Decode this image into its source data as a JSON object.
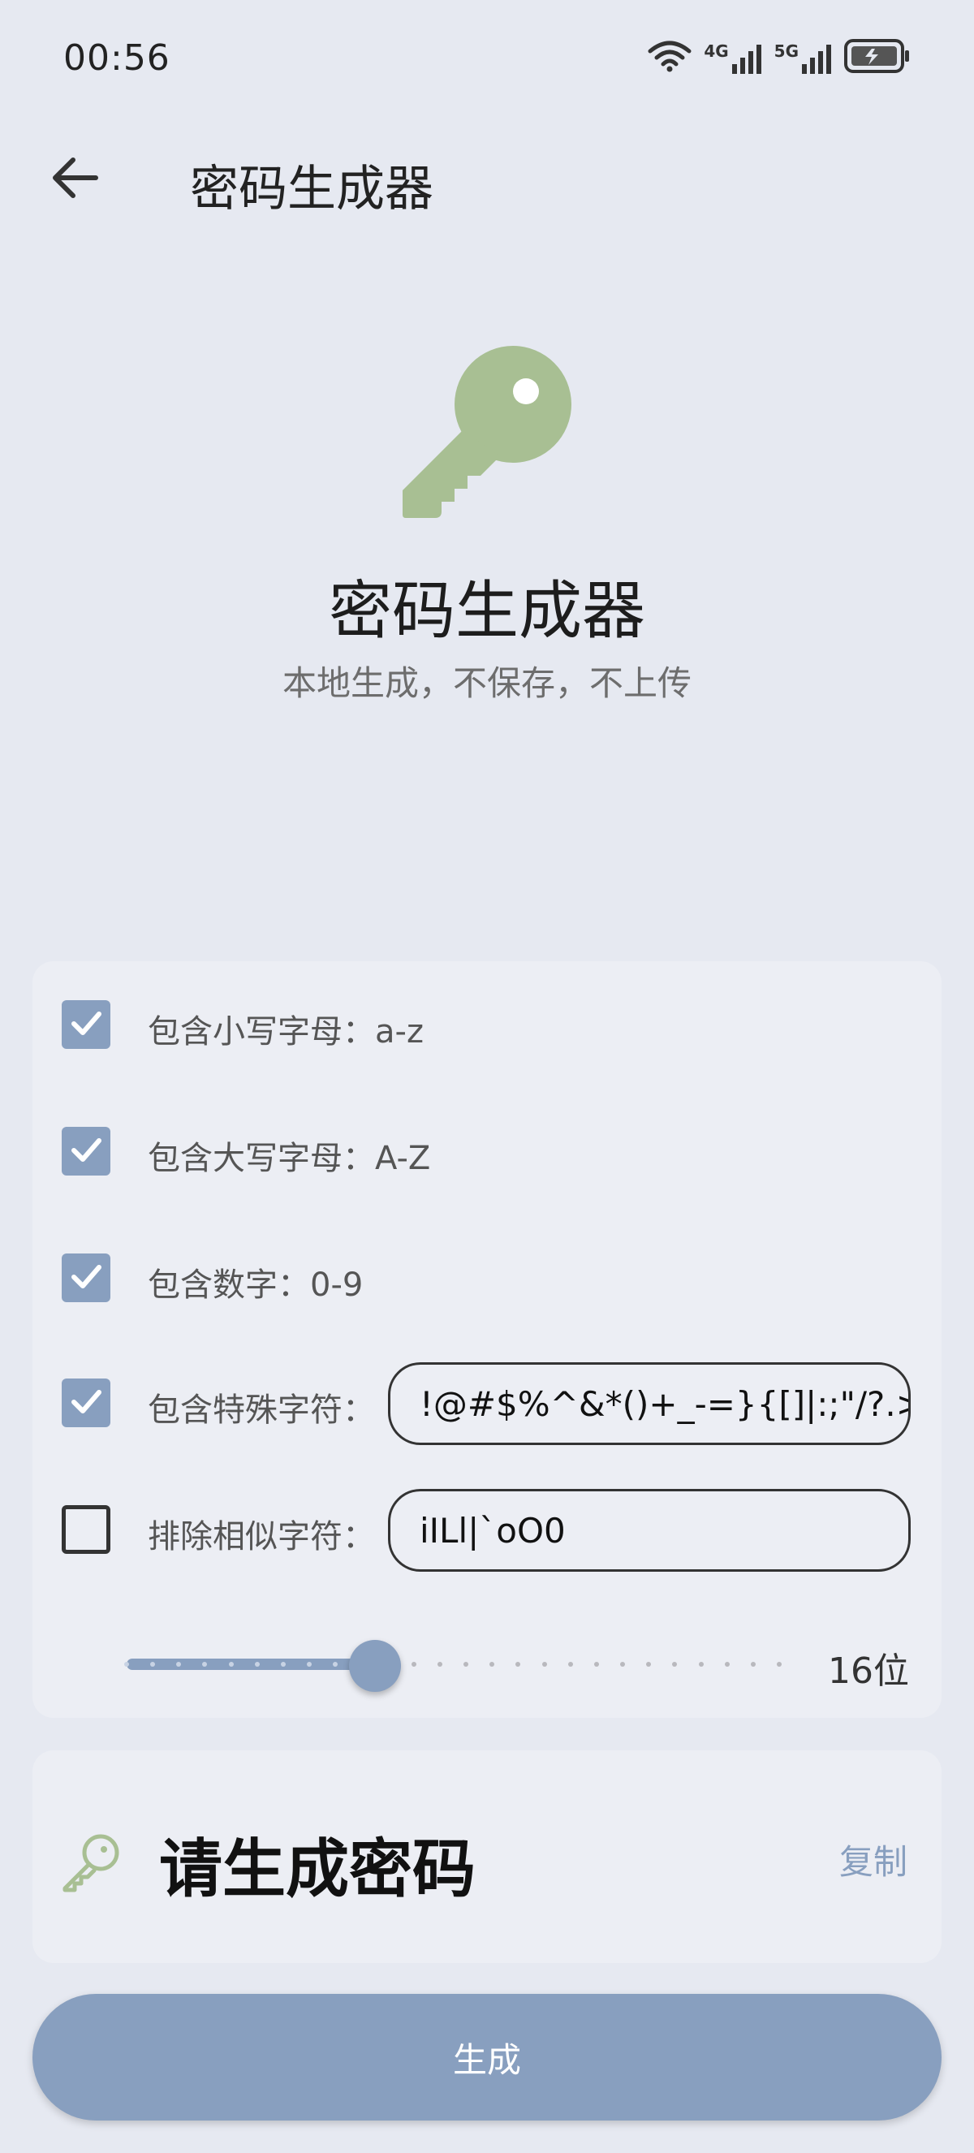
{
  "status_bar": {
    "time": "00:56",
    "icons": [
      "wifi-icon",
      "signal-4g-icon",
      "signal-5g-icon",
      "battery-charging-icon"
    ],
    "network_4g": "4G",
    "network_5g": "5G"
  },
  "app_bar": {
    "back_icon": "arrow-left-icon",
    "title": "密码生成器"
  },
  "hero": {
    "icon": "key-icon",
    "title": "密码生成器",
    "subtitle": "本地生成，不保存，不上传"
  },
  "options": {
    "lowercase": {
      "label": "包含小写字母：a-z",
      "checked": true
    },
    "uppercase": {
      "label": "包含大写字母：A-Z",
      "checked": true
    },
    "digits": {
      "label": "包含数字：0-9",
      "checked": true
    },
    "special": {
      "label": "包含特殊字符：",
      "checked": true,
      "value": "!@#$%^&*()+_-=}{[]|:;\"/?.>"
    },
    "exclude_similar": {
      "label": "排除相似字符：",
      "checked": false,
      "value": "iILl|`oO0"
    }
  },
  "length": {
    "value": 16,
    "display": "16位",
    "steps_total": 26,
    "step_index": 10
  },
  "result": {
    "icon": "key-icon",
    "text": "请生成密码",
    "copy_label": "复制"
  },
  "generate_label": "生成",
  "colors": {
    "background": "#e6e9f1",
    "card": "#eceef4",
    "accent": "#889fbf",
    "key_green": "#a8bf93"
  }
}
